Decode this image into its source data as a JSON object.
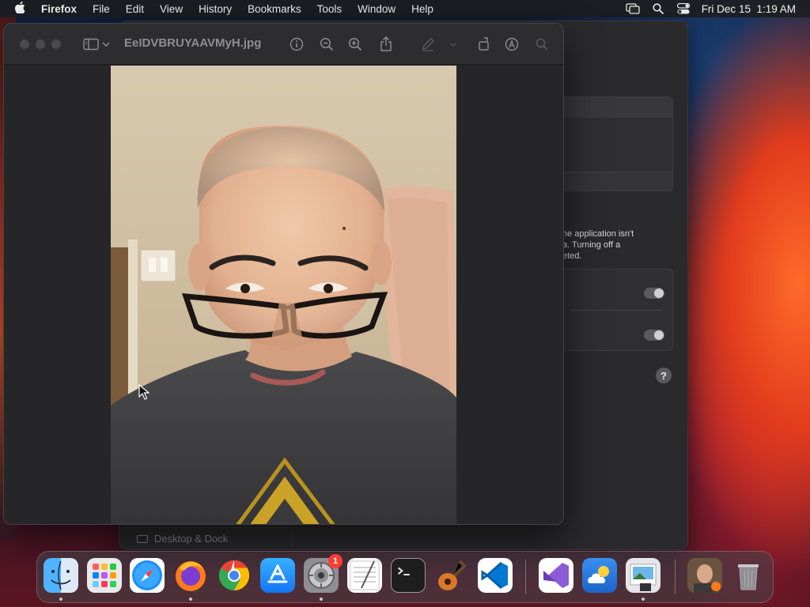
{
  "menubar": {
    "apple_icon": "apple-logo",
    "app_name": "Firefox",
    "menus": [
      "File",
      "Edit",
      "View",
      "History",
      "Bookmarks",
      "Tools",
      "Window",
      "Help"
    ],
    "datetime": "Fri Dec 15  1:19 AM",
    "status_icons": [
      "screen-mirroring-icon",
      "search-icon",
      "control-center-icon"
    ]
  },
  "preview": {
    "title": "EeIDVBRUYAAVMyH.jpg",
    "toolbar_icons": [
      "sidebar-toggle-icon",
      "chevron-down-icon",
      "info-icon",
      "zoom-out-icon",
      "zoom-in-icon",
      "share-icon",
      "markup-pen-icon",
      "rotate-icon",
      "annotate-icon",
      "search-icon"
    ]
  },
  "settings": {
    "sidebar_item": "Desktop & Dock",
    "description": "he application isn't\na. Turning off a\neted.",
    "help_label": "?"
  },
  "dock": {
    "apps": [
      {
        "name": "Finder",
        "icon": "finder-icon",
        "running": true
      },
      {
        "name": "Launchpad",
        "icon": "launchpad-icon",
        "running": false
      },
      {
        "name": "Safari",
        "icon": "safari-icon",
        "running": false
      },
      {
        "name": "Firefox",
        "icon": "firefox-icon",
        "running": true
      },
      {
        "name": "Chrome",
        "icon": "chrome-icon",
        "running": false
      },
      {
        "name": "App Store",
        "icon": "app-store-icon",
        "running": false
      },
      {
        "name": "System Settings",
        "icon": "system-settings-icon",
        "running": true,
        "badge": "1"
      },
      {
        "name": "TextEdit",
        "icon": "textedit-icon",
        "running": false
      },
      {
        "name": "Terminal",
        "icon": "terminal-icon",
        "running": false
      },
      {
        "name": "GarageBand",
        "icon": "garageband-icon",
        "running": false
      },
      {
        "name": "VS Code",
        "icon": "vscode-icon",
        "running": false
      },
      {
        "name": "Visual Studio",
        "icon": "visual-studio-icon",
        "running": false
      },
      {
        "name": "Weather",
        "icon": "weather-icon",
        "running": false
      },
      {
        "name": "Preview",
        "icon": "preview-icon",
        "running": true
      },
      {
        "name": "Downloads",
        "icon": "downloads-stack-icon",
        "running": false
      },
      {
        "name": "Trash",
        "icon": "trash-icon",
        "running": false
      }
    ]
  },
  "colors": {
    "badge": "#ff3b30",
    "window_bg": "#262628",
    "titlebar": "#2d2d2f"
  }
}
